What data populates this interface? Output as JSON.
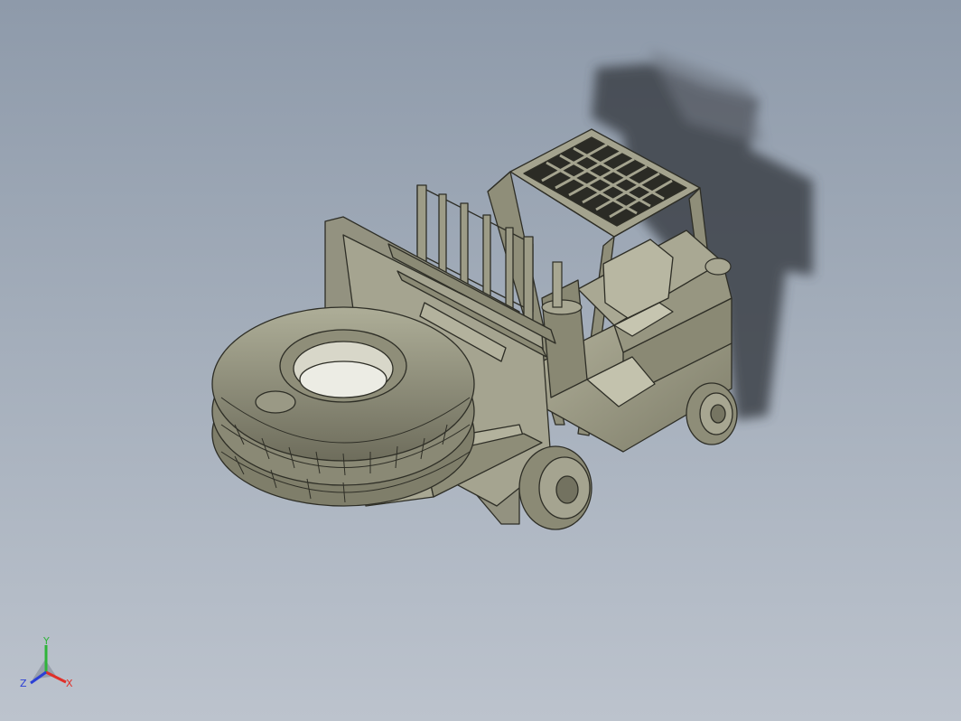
{
  "view": {
    "background_top": "#8e9aaa",
    "background_bottom": "#bcc3cd",
    "model_color": "#9b9a84",
    "shadow_color": "#3d4249"
  },
  "model": {
    "parts": [
      "forklift-body",
      "overhead-guard",
      "mast",
      "tire-clamp-attachment",
      "tire",
      "wheels",
      "seat",
      "steering-wheel"
    ]
  },
  "triad": {
    "x_label": "X",
    "y_label": "Y",
    "z_label": "Z",
    "x_color": "#e0302a",
    "y_color": "#2fb43a",
    "z_color": "#2b3fd6"
  }
}
